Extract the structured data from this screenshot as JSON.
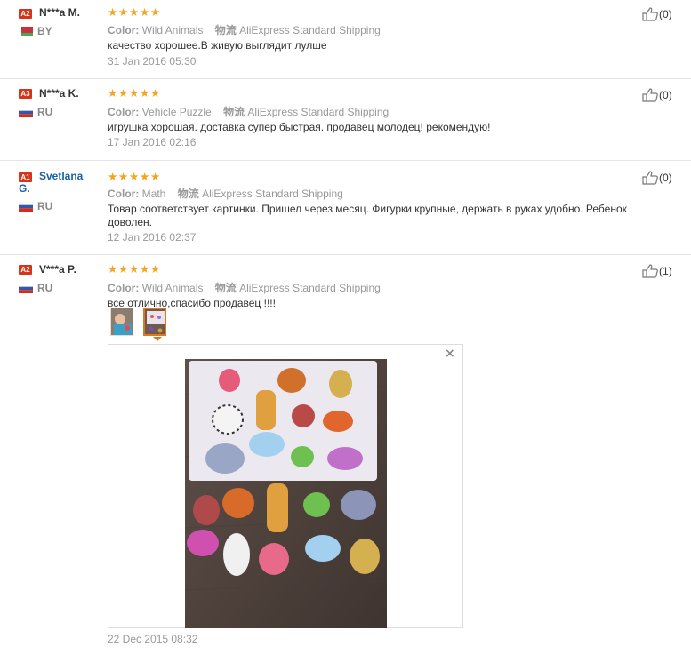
{
  "labels": {
    "color": "Color:",
    "logistics": "物流"
  },
  "star_glyph": "★",
  "rating": {
    "stars": 5,
    "max": 5
  },
  "reviews": [
    {
      "level": "A2",
      "name": "N***a M.",
      "country": "BY",
      "color_value": "Wild Animals",
      "shipping": "AliExpress Standard Shipping",
      "text": "качество хорошее.В живую выглядит лулше",
      "date": "31 Jan 2016 05:30",
      "likes": "(0)"
    },
    {
      "level": "A3",
      "name": "N***a K.",
      "country": "RU",
      "color_value": "Vehicle Puzzle",
      "shipping": "AliExpress Standard Shipping",
      "text": "игрушка хорошая. доставка супер быстрая. продавец молодец! рекомендую!",
      "date": "17 Jan 2016 02:16",
      "likes": "(0)"
    },
    {
      "level": "A1",
      "name_line1": "Svetlana",
      "name_line2": "G.",
      "country": "RU",
      "color_value": "Math",
      "shipping": "AliExpress Standard Shipping",
      "text": "Товар соответствует картинки. Пришел через месяц. Фигурки крупные, держать в руках удобно. Ребенок доволен.",
      "date": "12 Jan 2016 02:37",
      "likes": "(0)"
    },
    {
      "level": "A2",
      "name": "V***a P.",
      "country": "RU",
      "color_value": "Wild Animals",
      "shipping": "AliExpress Standard Shipping",
      "text": "все отлично,спасибо продавец !!!!",
      "date": "22 Dec 2015 08:32",
      "likes": "(1)",
      "close_symbol": "×"
    }
  ],
  "colors": {
    "accent_star": "#f7a31b",
    "level_badge": "#d7341b",
    "selected_thumb": "#e0781b",
    "name_link": "#1a5fa8"
  }
}
